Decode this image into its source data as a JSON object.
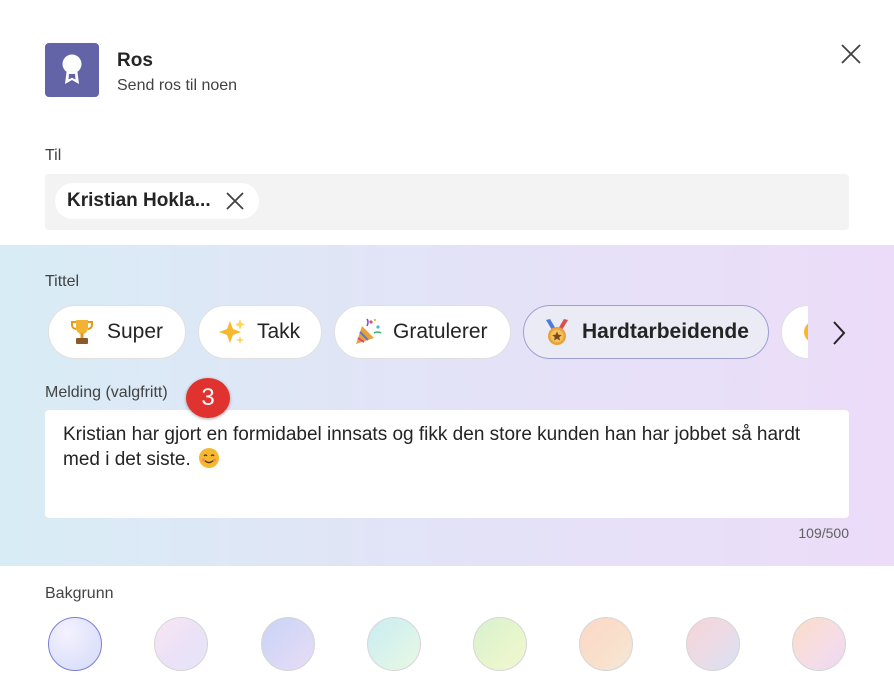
{
  "header": {
    "title": "Ros",
    "subtitle": "Send ros til noen",
    "accent_color": "#6264a7",
    "icon": "ribbon-badge-icon",
    "close_icon": "close-icon"
  },
  "to": {
    "label": "Til",
    "recipient": "Kristian Hokla...",
    "remove_icon": "close-icon"
  },
  "title_section": {
    "label": "Tittel",
    "options": [
      {
        "label": "Super",
        "icon": "trophy-icon",
        "selected": false
      },
      {
        "label": "Takk",
        "icon": "sparkles-icon",
        "selected": false
      },
      {
        "label": "Gratulerer",
        "icon": "party-popper-icon",
        "selected": false
      },
      {
        "label": "Hardtarbeidende",
        "icon": "medal-icon",
        "selected": true
      }
    ],
    "next_icon": "chevron-right-icon"
  },
  "message": {
    "label": "Melding (valgfritt)",
    "text": "Kristian har gjort en formidabel innsats og fikk den store kunden han har jobbet så hardt med i det siste.",
    "emoji": "smiling-face-icon",
    "counter": "109/500"
  },
  "annotation_badge": "3",
  "background": {
    "label": "Bakgrunn",
    "selected_index": 0,
    "swatches": [
      {
        "name": "lavender-blue",
        "color": "#dfe3fb"
      },
      {
        "name": "pink-lilac",
        "color": "#f1e2f5"
      },
      {
        "name": "periwinkle",
        "color": "#d6dcf8"
      },
      {
        "name": "mint",
        "color": "#d9f3ee"
      },
      {
        "name": "lime",
        "color": "#e9f5cf"
      },
      {
        "name": "peach",
        "color": "#f8dccd"
      },
      {
        "name": "rose-blue",
        "color": "#ecdbe6"
      },
      {
        "name": "peach-pink",
        "color": "#f6dfe7"
      }
    ]
  }
}
